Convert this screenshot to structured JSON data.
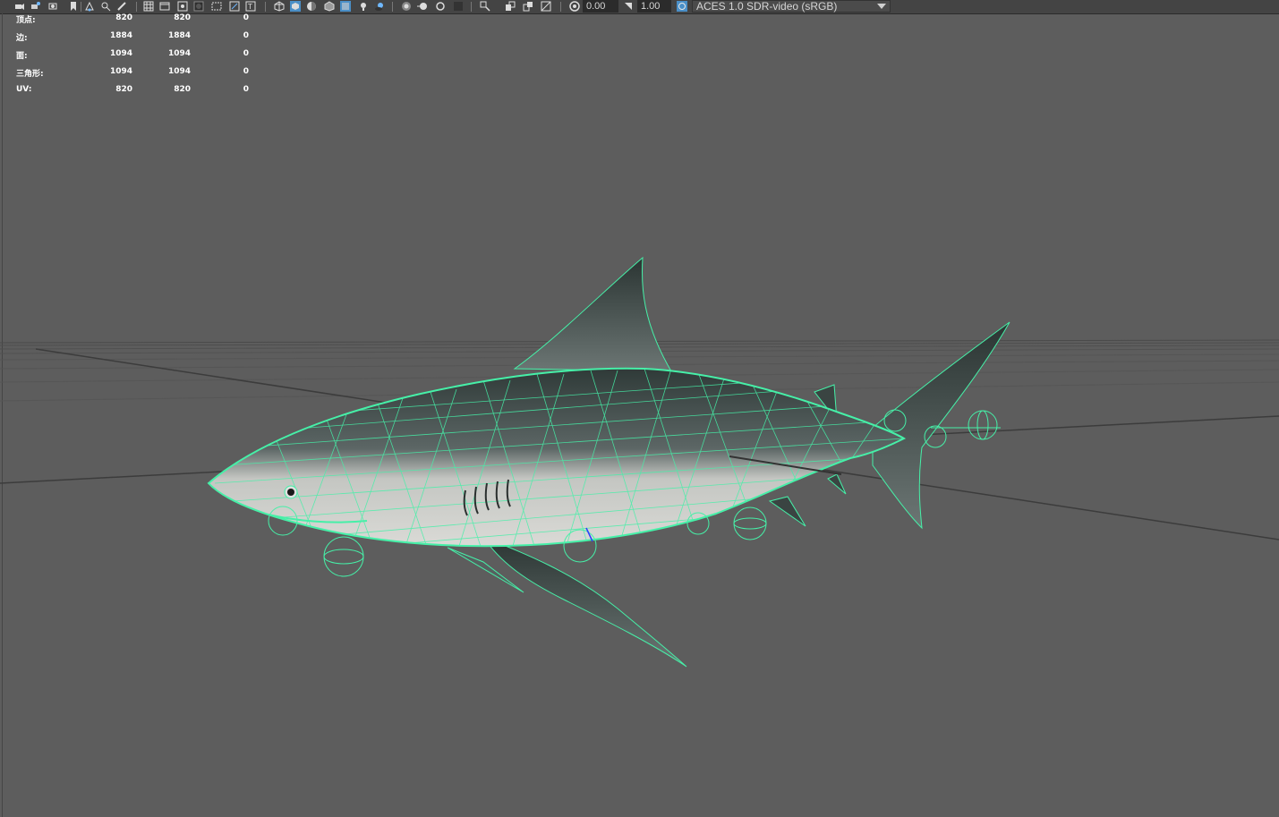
{
  "toolbar": {
    "icons": [
      "camera-icon",
      "camera-attr-icon",
      "bookmark-icon",
      "image-plane-icon",
      "grid-icon",
      "film-gate-icon",
      "resolution-gate-icon",
      "gate-mask-icon",
      "field-chart-icon",
      "safe-action-icon",
      "wireframe-icon",
      "smooth-shade-icon",
      "default-material-icon",
      "xray-icon",
      "lights-icon",
      "shadows-icon",
      "ambient-occlusion-icon",
      "motion-blur-icon",
      "antialias-icon",
      "isolate-icon",
      "xray-joints-icon",
      "xray-active-icon",
      "backface-icon",
      "exposure-icon",
      "gamma-icon",
      "color-management-icon"
    ],
    "exposure": "0.00",
    "gamma": "1.00",
    "color_space": "ACES 1.0 SDR-video (sRGB)"
  },
  "hud": {
    "rows": [
      {
        "label": "顶点:",
        "v1": "820",
        "v2": "820",
        "v3": "0"
      },
      {
        "label": "边:",
        "v1": "1884",
        "v2": "1884",
        "v3": "0"
      },
      {
        "label": "面:",
        "v1": "1094",
        "v2": "1094",
        "v3": "0"
      },
      {
        "label": "三角形:",
        "v1": "1094",
        "v2": "1094",
        "v3": "0"
      },
      {
        "label": "UV:",
        "v1": "820",
        "v2": "820",
        "v3": "0"
      }
    ]
  },
  "colors": {
    "viewport_bg": "#5d5d5d",
    "wireframe": "#46f0a8",
    "toolbar_bg": "#444444"
  }
}
